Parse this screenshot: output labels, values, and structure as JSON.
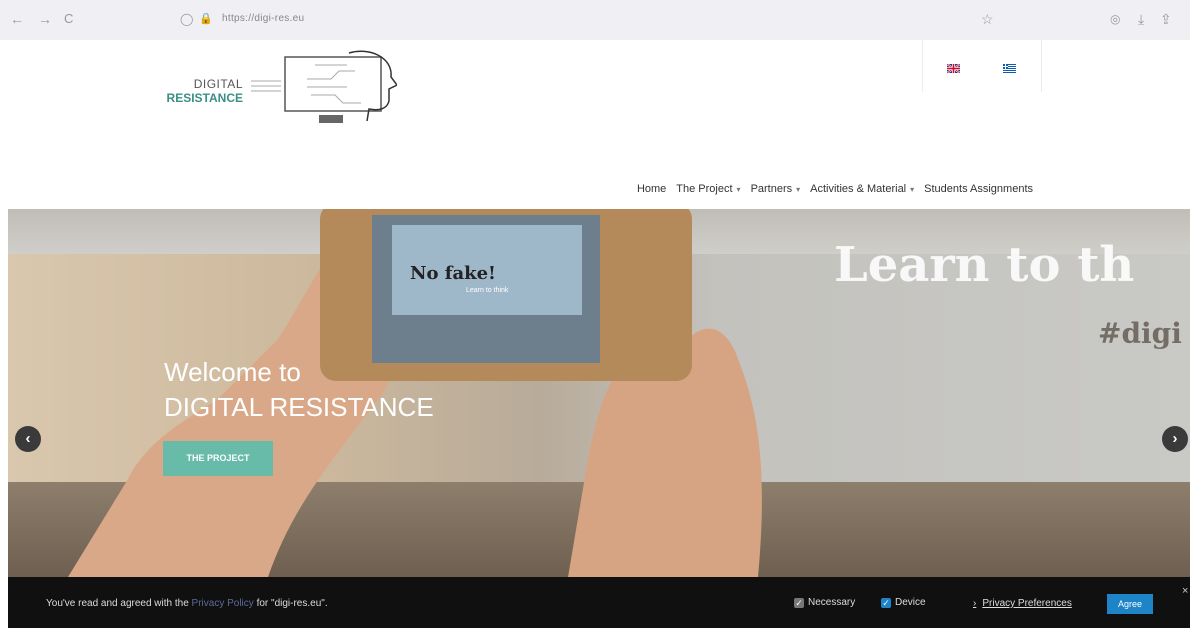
{
  "browser": {
    "back_icon": "←",
    "forward_icon": "→",
    "reload_icon": "C",
    "shield_icon": "◯",
    "lock_icon": "🔒",
    "url": "https://digi-res.eu",
    "star_icon": "☆",
    "pocket_icon": "◎",
    "download_icon": "⤓",
    "share_icon": "⇪"
  },
  "logo": {
    "word1": "DIGITAL",
    "word2": "RESISTANCE"
  },
  "nav": [
    {
      "label": "Home",
      "has_caret": false
    },
    {
      "label": "The Project",
      "has_caret": true
    },
    {
      "label": "Partners",
      "has_caret": true
    },
    {
      "label": "Activities & Material",
      "has_caret": true
    },
    {
      "label": "Students Assignments",
      "has_caret": false
    }
  ],
  "nav_caret": "▾",
  "hero": {
    "title_line1": "Welcome to",
    "title_line2": "DIGITAL RESISTANCE",
    "cta_label": "THE PROJECT",
    "bg_text": "Learn to th",
    "bg_hashtag": "#digi",
    "phone_text": "No fake!",
    "phone_subtext": "Learn to think",
    "prev_icon": "‹",
    "next_icon": "›"
  },
  "cookie": {
    "text_before": "You've read and agreed with the ",
    "link_text": "Privacy Policy",
    "text_after": " for \"digi-res.eu\".",
    "opt_necessary": "Necessary",
    "opt_device": "Device",
    "pref_arrow": "›",
    "pref_label": "Privacy Preferences",
    "agree_label": "Agree",
    "close_icon": "×",
    "check_mark": "✓"
  },
  "colors": {
    "accent": "#68bba9",
    "agree_button": "#1e84c8",
    "cookie_bg": "#101010"
  }
}
